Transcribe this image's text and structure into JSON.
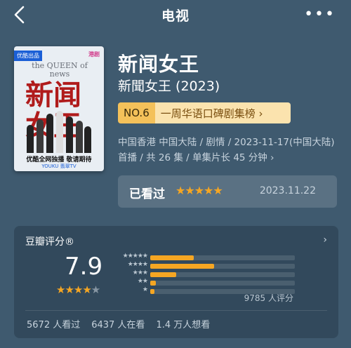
{
  "header": {
    "title": "电视",
    "more": "•••"
  },
  "poster": {
    "badge": "优酷出品",
    "network": "港剧",
    "en_title": "the QUEEN of news",
    "cn_title": "新闻女王",
    "promo": "优酷全网独播 敬请期待",
    "logos": "YOUKU  翡翠TV"
  },
  "show": {
    "title": "新闻女王",
    "subtitle": "新聞女王 (2023)",
    "rank_no": "NO.6",
    "rank_list": "一周华语口碑剧集榜 ›",
    "meta": "中国香港 中国大陆 / 剧情 / 2023-11-17(中国大陆) 首播 / 共 26 集 / 单集片长 45 分钟 ›"
  },
  "watched": {
    "label": "已看过",
    "stars": "★★★★★",
    "date": "2023.11.22",
    "user_rating": 5
  },
  "rating": {
    "heading": "豆瓣评分®",
    "chevron": "›",
    "score": "7.9",
    "stars_on": "★★★★",
    "stars_off": "★",
    "distribution": [
      {
        "label": "★★★★★",
        "value": 0.3
      },
      {
        "label": "★★★★",
        "value": 0.44
      },
      {
        "label": "★★★",
        "value": 0.18
      },
      {
        "label": "★★",
        "value": 0.04
      },
      {
        "label": "★",
        "value": 0.03
      }
    ],
    "count": "9785 人评分",
    "stats": [
      "5672 人看过",
      "6437 人在看",
      "1.4 万人想看"
    ]
  },
  "colors": {
    "background": "#3f5a6f",
    "accent": "#f5a623"
  }
}
